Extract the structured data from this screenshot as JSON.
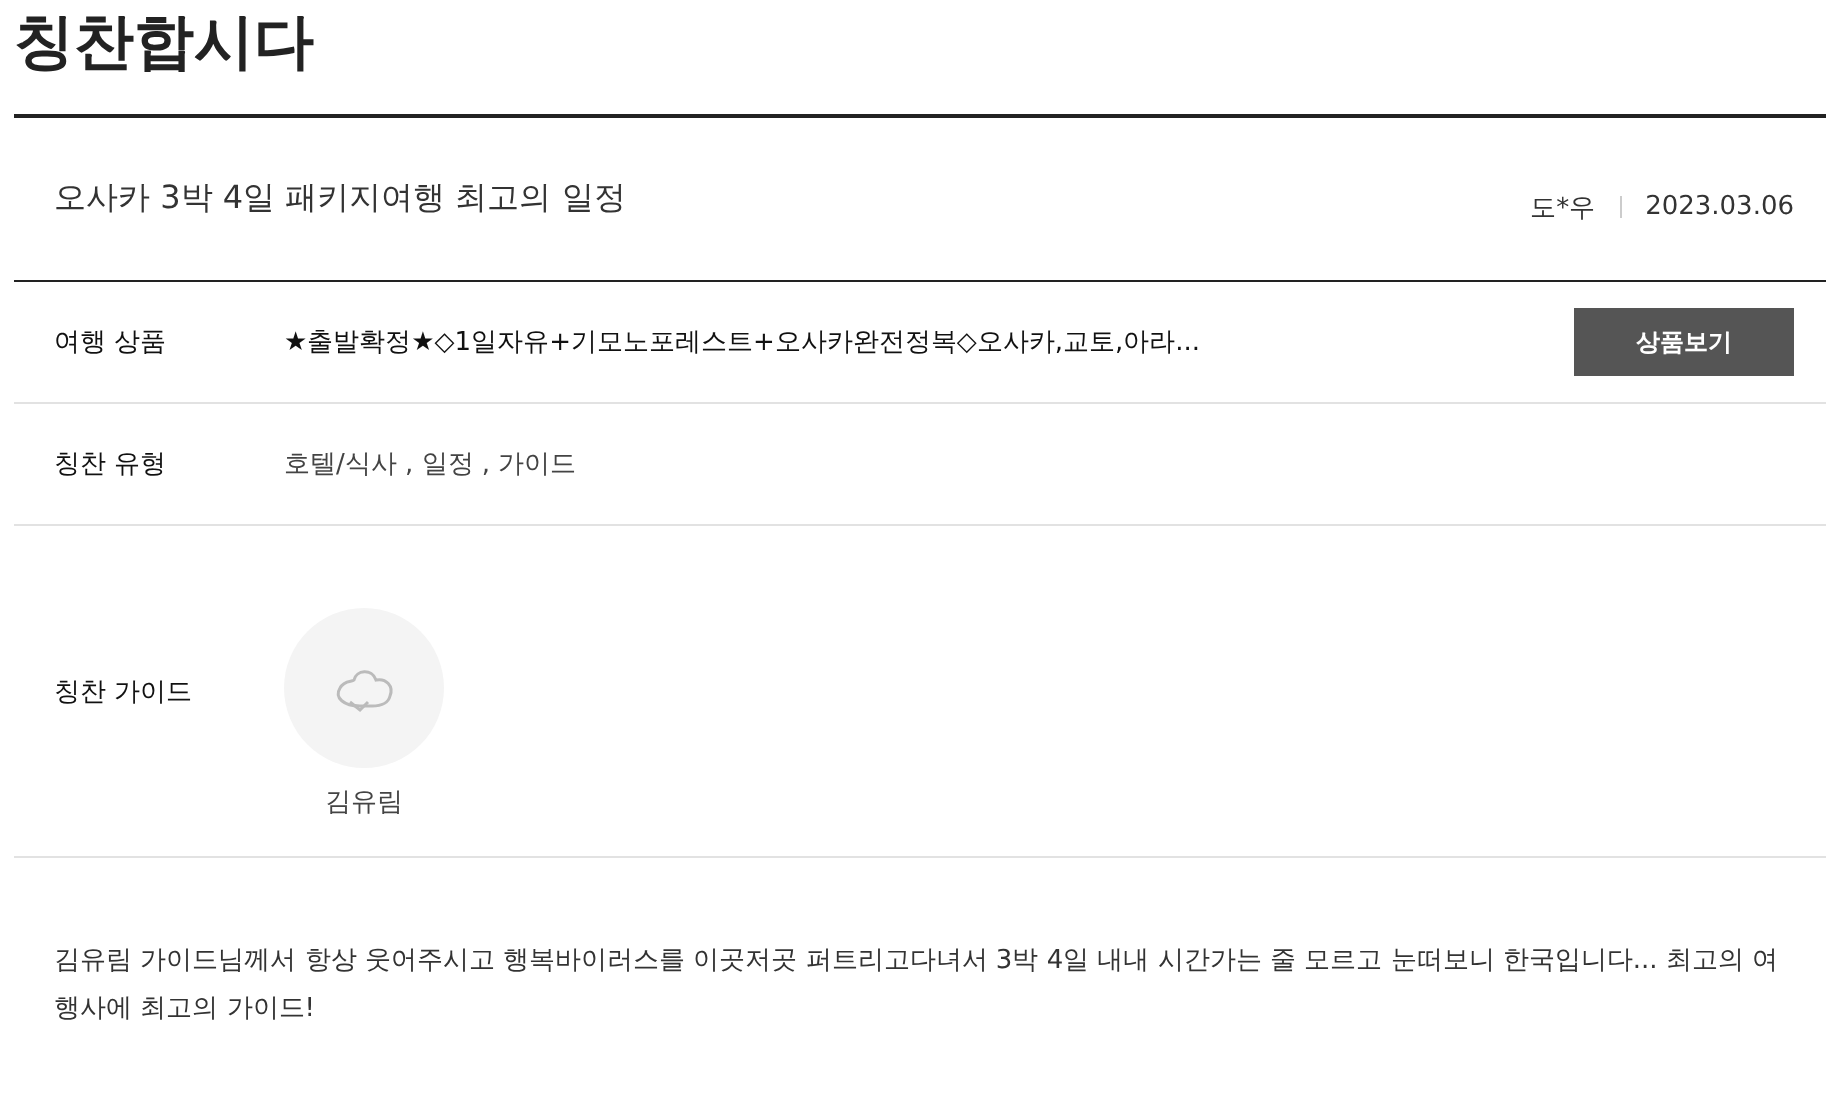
{
  "page_title": "칭찬합시다",
  "post": {
    "title": "오사카 3박 4일 패키지여행 최고의 일정",
    "author": "도*우",
    "date": "2023.03.06"
  },
  "rows": [
    {
      "kind": "product",
      "label": "여행 상품",
      "value": "★출발확정★◇1일자유+기모노포레스트+오사카완전정복◇오사카,교토,아라...",
      "button": "상품보기"
    },
    {
      "kind": "text",
      "label": "칭찬 유형",
      "value": "호텔/식사 , 일정 , 가이드"
    },
    {
      "kind": "guide",
      "label": "칭찬 가이드",
      "guide_name": "김유림"
    }
  ],
  "content": "김유림 가이드님께서 항상 웃어주시고 행복바이러스를 이곳저곳 퍼트리고다녀서 3박 4일 내내 시간가는 줄 모르고 눈떠보니 한국입니다... 최고의 여행사에 최고의 가이드!"
}
